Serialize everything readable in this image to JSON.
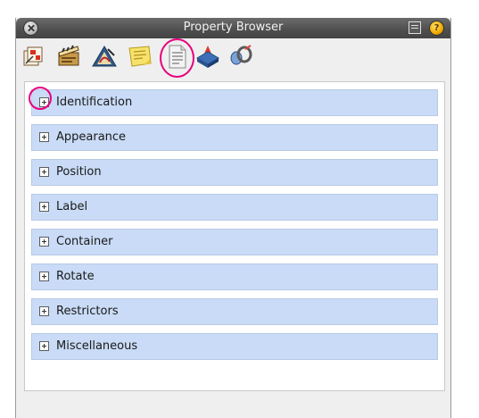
{
  "window": {
    "title": "Property Browser",
    "help_label": "?"
  },
  "toolbar": {
    "tools": [
      {
        "name": "sequence-tool-icon",
        "active": false
      },
      {
        "name": "clapperboard-tool-icon",
        "active": false
      },
      {
        "name": "sketch-tool-icon",
        "active": false
      },
      {
        "name": "sticky-note-tool-icon",
        "active": false
      },
      {
        "name": "properties-document-icon",
        "active": true
      },
      {
        "name": "diamond-layer-icon",
        "active": false
      },
      {
        "name": "connector-tool-icon",
        "active": false
      }
    ]
  },
  "sections": [
    {
      "label": "Identification"
    },
    {
      "label": "Appearance"
    },
    {
      "label": "Position"
    },
    {
      "label": "Label"
    },
    {
      "label": "Container"
    },
    {
      "label": "Rotate"
    },
    {
      "label": "Restrictors"
    },
    {
      "label": "Miscellaneous"
    }
  ],
  "colors": {
    "section_bg": "#c9dbf6",
    "highlight": "#e6007e",
    "titlebar": "#4e4e4e"
  }
}
